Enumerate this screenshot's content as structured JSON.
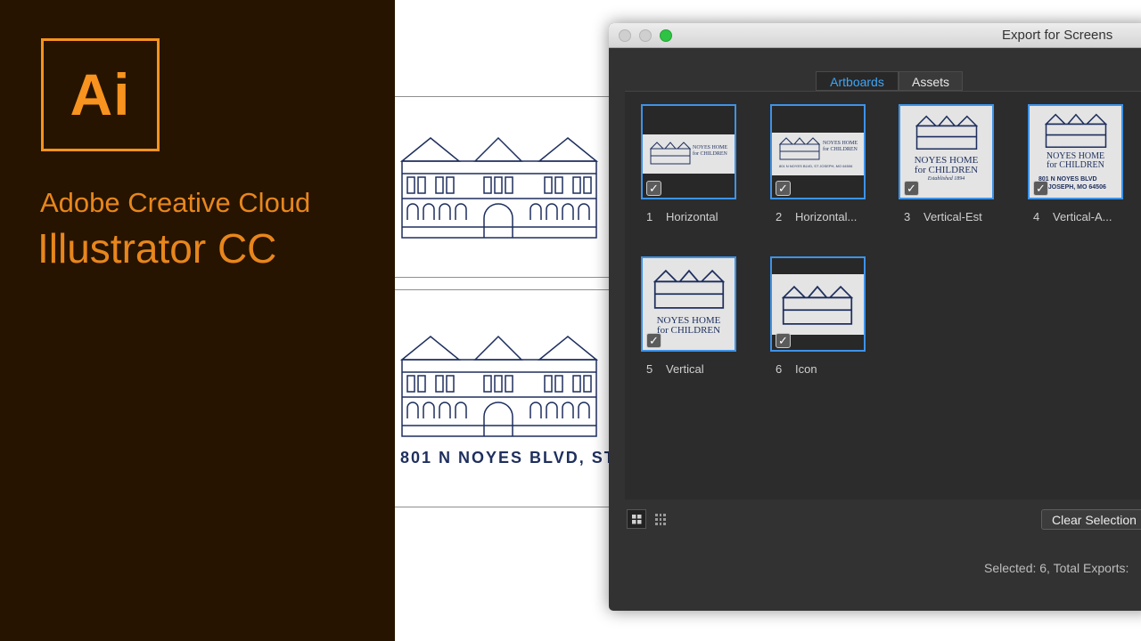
{
  "brand": {
    "logo_text": "Ai",
    "line1": "Adobe Creative Cloud",
    "line2": "Illustrator CC"
  },
  "canvas": {
    "address_text": "801 N NOYES BLVD, ST"
  },
  "dialog": {
    "title": "Export for Screens",
    "tabs": [
      {
        "label": "Artboards",
        "active": true
      },
      {
        "label": "Assets",
        "active": false
      }
    ],
    "artboards": [
      {
        "number": "1",
        "name": "Horizontal",
        "checked": true
      },
      {
        "number": "2",
        "name": "Horizontal...",
        "checked": true
      },
      {
        "number": "3",
        "name": "Vertical-Est",
        "checked": true
      },
      {
        "number": "4",
        "name": "Vertical-A...",
        "checked": true
      },
      {
        "number": "5",
        "name": "Vertical",
        "checked": true
      },
      {
        "number": "6",
        "name": "Icon",
        "checked": true
      }
    ],
    "thumb_text": {
      "name_line1": "NOYES HOME",
      "name_line2": "for CHILDREN",
      "established": "Established 1894",
      "addr_line1": "801 N NOYES BLVD",
      "addr_line2": "ST JOSEPH, MO 64506",
      "addr_combined": "801 N NOYES BLVD, ST JOSEPH, MO 64506"
    },
    "clear_selection_label": "Clear Selection",
    "status_text": "Selected: 6, Total Exports:"
  },
  "colors": {
    "brand_bg": "#261400",
    "brand_orange": "#f7931e",
    "dialog_bg": "#323232",
    "selection_blue": "#3d93e8",
    "logo_navy": "#1e2f5e"
  }
}
